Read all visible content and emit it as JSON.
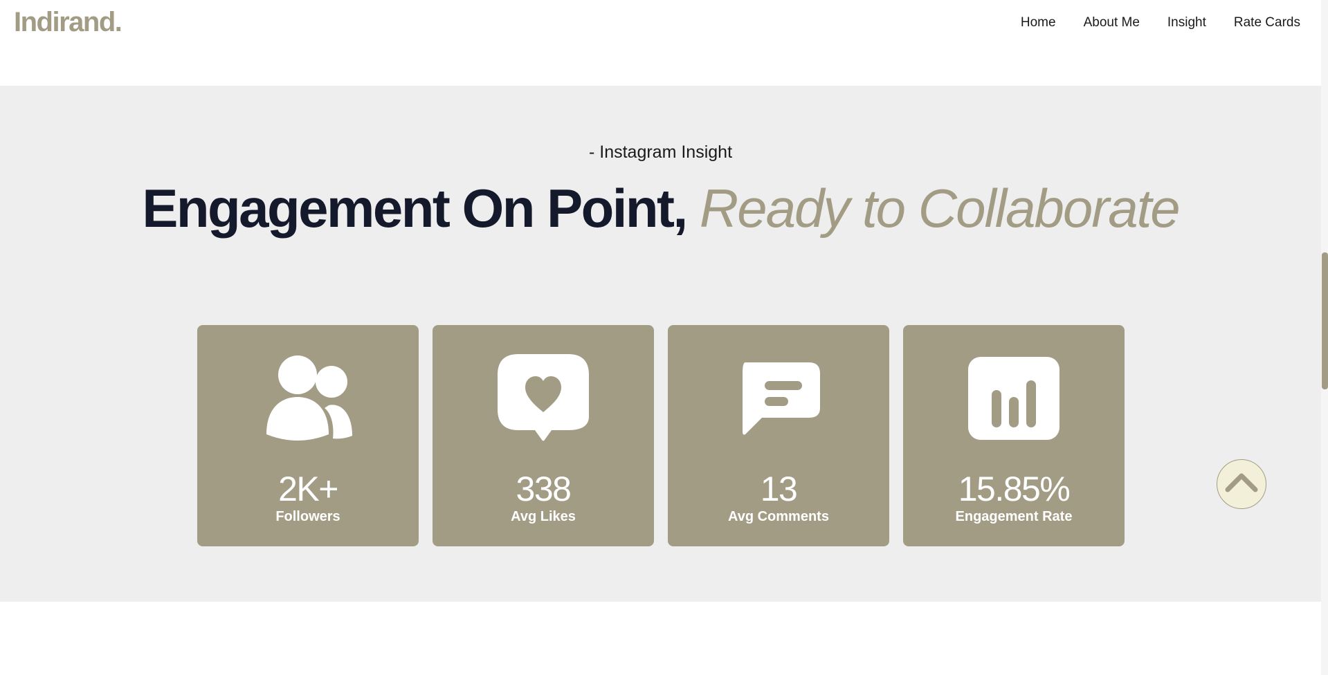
{
  "brand": {
    "logo": "Indirand."
  },
  "nav": {
    "items": [
      "Home",
      "About Me",
      "Insight",
      "Rate Cards"
    ]
  },
  "insight": {
    "eyebrow": "- Instagram Insight",
    "headline_main": "Engagement On Point,",
    "headline_accent": "Ready to Collaborate",
    "stats": [
      {
        "icon": "followers-icon",
        "value": "2K+",
        "label": "Followers"
      },
      {
        "icon": "heart-message-icon",
        "value": "338",
        "label": "Avg Likes"
      },
      {
        "icon": "comment-icon",
        "value": "13",
        "label": "Avg Comments"
      },
      {
        "icon": "bar-chart-icon",
        "value": "15.85%",
        "label": "Engagement Rate"
      }
    ]
  },
  "colors": {
    "accent": "#a39c85",
    "headline": "#141a2b",
    "section_bg": "#eeeeee",
    "back_to_top_bg": "#f2f0d8"
  }
}
